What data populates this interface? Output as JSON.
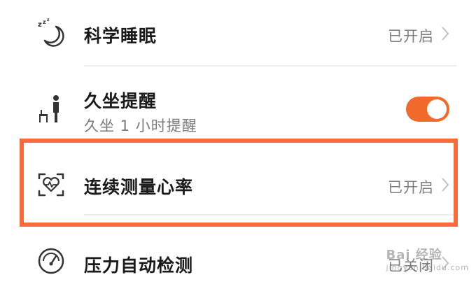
{
  "settings": {
    "items": [
      {
        "icon": "sleep-moon-icon",
        "title": "科学睡眠",
        "status": "已开启"
      },
      {
        "icon": "sedentary-person-icon",
        "title": "久坐提醒",
        "subtitle": "久坐 1 小时提醒",
        "toggle_on": true
      },
      {
        "icon": "heart-rate-scan-icon",
        "title": "连续测量心率",
        "status": "已开启"
      },
      {
        "icon": "gauge-icon",
        "title": "压力自动检测",
        "status": "已关闭"
      }
    ]
  },
  "colors": {
    "accent": "#f26a2b",
    "highlight": "#fb6a3c",
    "divider": "#ececec",
    "secondary_text": "#7f7f7f"
  },
  "watermark": {
    "text": "Bai 经验",
    "url_text": "jingyan.baidu.com"
  }
}
